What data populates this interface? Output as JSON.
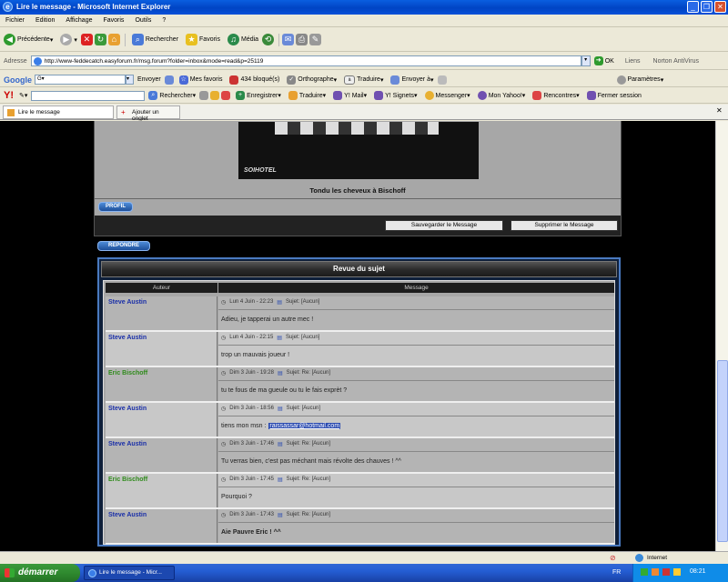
{
  "window": {
    "title": "Lire le message - Microsoft Internet Explorer"
  },
  "menu": [
    "Fichier",
    "Edition",
    "Affichage",
    "Favoris",
    "Outils",
    "?"
  ],
  "toolbar": {
    "back": "Précédente",
    "search": "Rechercher",
    "favorites": "Favoris",
    "media": "Média"
  },
  "address": {
    "label": "Adresse",
    "url": "http://www-feddecatch.easyforum.fr/msg.forum?folder=inbox&mode=read&p=25119",
    "go": "OK",
    "links": "Liens",
    "antivirus": "Norton AntiVirus"
  },
  "google": {
    "logo": "Google",
    "send": "Envoyer",
    "bookmarks": "Mes favoris",
    "blocked": "434 bloqué(s)",
    "spell": "Orthographe",
    "translate": "Traduire",
    "send_to": "Envoyer à",
    "settings": "Paramètres"
  },
  "yahoo": {
    "logo": "Y!",
    "search": "Rechercher",
    "save": "Enregistrer",
    "translate": "Traduire",
    "mail": "Y! Mail",
    "signets": "Y! Signets",
    "messenger": "Messenger",
    "myyahoo": "Mon Yahoo!",
    "meet": "Rencontres",
    "close": "Fermer session"
  },
  "tabs": {
    "current": "Lire le message",
    "add": "Ajouter un onglet"
  },
  "post": {
    "image_logo": "SOIHOTEL",
    "caption": "Tondu les cheveux à Bischoff",
    "profile_btn": "PROFIL",
    "save_btn": "Sauvegarder le Message",
    "delete_btn": "Supprimer le Message",
    "reply_btn": "REPONDRE"
  },
  "review": {
    "title": "Revue du sujet",
    "col_author": "Auteur",
    "col_message": "Message",
    "rows": [
      {
        "author": "Steve Austin",
        "date": "Lun 4 Juin - 22:23",
        "subject": "Sujet: [Aucun]",
        "text": "Adieu, je tapperai un autre mec !"
      },
      {
        "author": "Steve Austin",
        "date": "Lun 4 Juin - 22:15",
        "subject": "Sujet: [Aucun]",
        "text": "trop un mauvais joueur !"
      },
      {
        "author": "Eric Bischoff",
        "date": "Dim 3 Juin - 19:28",
        "subject": "Sujet: Re: [Aucun]",
        "text": "tu te fous de ma gueule ou tu le fais exprèt ?"
      },
      {
        "author": "Steve Austin",
        "date": "Dim 3 Juin - 18:56",
        "subject": "Sujet: [Aucun]",
        "text": "tiens mon msn :",
        "link": "raissassar@hotmail.com"
      },
      {
        "author": "Steve Austin",
        "date": "Dim 3 Juin - 17:46",
        "subject": "Sujet: Re: [Aucun]",
        "text": "Tu verras bien, c'est pas méchant mais révolte des chauves ! ^^"
      },
      {
        "author": "Eric Bischoff",
        "date": "Dim 3 Juin - 17:45",
        "subject": "Sujet: Re: [Aucun]",
        "text": "Pourquoi ?"
      },
      {
        "author": "Steve Austin",
        "date": "Dim 3 Juin - 17:43",
        "subject": "Sujet: Re: [Aucun]",
        "text": "Aie Pauvre Eric ! ^^"
      }
    ]
  },
  "colors": {
    "steve": "#1a2fa8",
    "eric": "#2e8a1a"
  },
  "status": {
    "zone": "Internet"
  },
  "taskbar": {
    "start": "démarrer",
    "task": "Lire le message - Micr...",
    "lang": "FR",
    "time": "08:21"
  }
}
